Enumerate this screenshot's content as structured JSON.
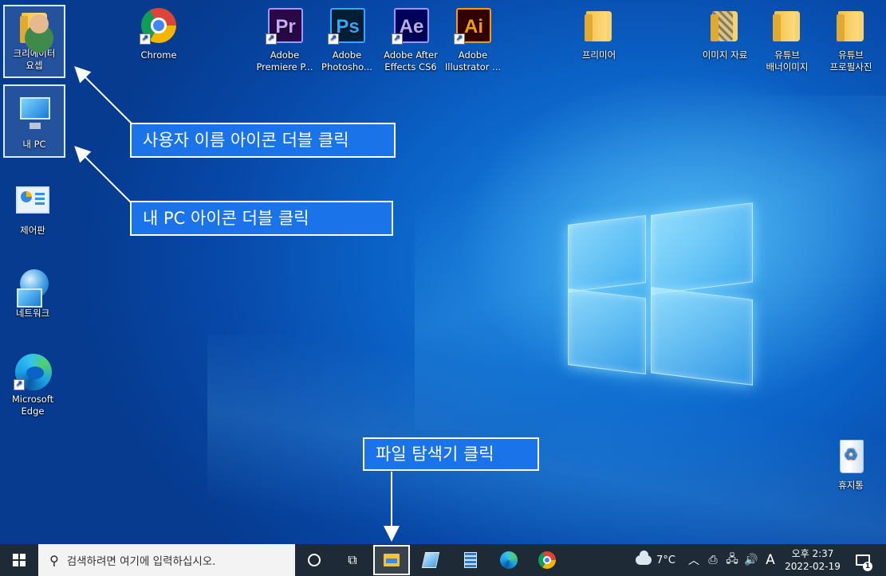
{
  "desktop": {
    "icons": [
      {
        "label": "크리에이터 요셉",
        "icon": "user-folder-icon"
      },
      {
        "label": "Chrome",
        "icon": "chrome-icon"
      },
      {
        "label": "Adobe Premiere P...",
        "icon": "premiere-icon",
        "glyph": "Pr",
        "color": "#9999ff",
        "bg": "#2a0845"
      },
      {
        "label": "Adobe Photosho...",
        "icon": "photoshop-icon",
        "glyph": "Ps",
        "color": "#31a8ff",
        "bg": "#001e36"
      },
      {
        "label": "Adobe After Effects CS6",
        "icon": "after-effects-icon",
        "glyph": "Ae",
        "color": "#9999ff",
        "bg": "#00005b"
      },
      {
        "label": "Adobe Illustrator ...",
        "icon": "illustrator-icon",
        "glyph": "Ai",
        "color": "#ff9a00",
        "bg": "#330000"
      },
      {
        "label": "프리미어",
        "icon": "folder-icon"
      },
      {
        "label": "이미지 자료",
        "icon": "image-folder-icon"
      },
      {
        "label": "유튜브 배너이미지",
        "icon": "folder-icon"
      },
      {
        "label": "유튜브 프로필사진",
        "icon": "folder-icon"
      },
      {
        "label": "내 PC",
        "icon": "computer-icon"
      },
      {
        "label": "제어판",
        "icon": "control-panel-icon"
      },
      {
        "label": "네트워크",
        "icon": "network-icon"
      },
      {
        "label": "Microsoft Edge",
        "icon": "edge-icon"
      },
      {
        "label": "휴지통",
        "icon": "recycle-bin-icon"
      }
    ]
  },
  "callouts": {
    "user": "사용자 이름 아이콘 더블 클릭",
    "mypc": "내 PC 아이콘 더블 클릭",
    "explorer": "파일 탐색기 클릭"
  },
  "taskbar": {
    "search_placeholder": "검색하려면 여기에 입력하십시오.",
    "weather": "7°C",
    "ime": "A",
    "time": "오후 2:37",
    "date": "2022-02-19",
    "notification_count": "1"
  },
  "colors": {
    "taskbar_bg": "#1e2a36",
    "callout_bg": "#1a73e8",
    "accent": "#0b63c7"
  }
}
